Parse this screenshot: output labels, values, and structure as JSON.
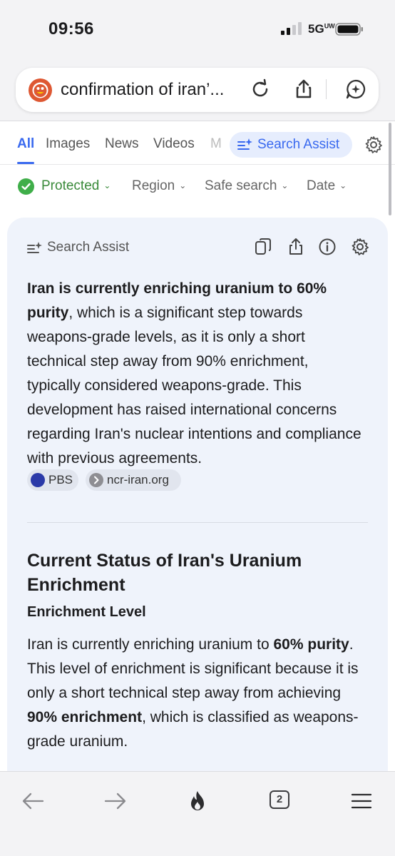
{
  "status_bar": {
    "time": "09:56",
    "network": "5G",
    "network_sup": "UW"
  },
  "url_bar": {
    "query": "confirmation of iran’..."
  },
  "tabs": [
    {
      "label": "All",
      "active": true
    },
    {
      "label": "Images"
    },
    {
      "label": "News"
    },
    {
      "label": "Videos"
    },
    {
      "label": "M"
    }
  ],
  "search_assist_tab": "Search Assist",
  "filters": {
    "protected": "Protected",
    "region": "Region",
    "safe_search": "Safe search",
    "date": "Date"
  },
  "card": {
    "header": "Search Assist",
    "summary_bold": "Iran is currently enriching uranium to 60% purity",
    "summary_rest": ", which is a significant step towards weapons-grade levels, as it is only a short technical step away from 90% enrichment, typically considered weapons-grade. This development has raised international concerns regarding Iran's nuclear intentions and compliance with previous agreements.",
    "sources": [
      {
        "label": "PBS",
        "color": "#2b3aa8"
      },
      {
        "label": "ncr-iran.org",
        "color": "#8e8e93"
      }
    ],
    "heading": "Current Status of Iran's Uranium Enrichment",
    "subheading": "Enrichment Level",
    "para": {
      "t1": "Iran is currently enriching uranium to ",
      "b1": "60% purity",
      "t2": ". This level of enrichment is significant because it is only a short technical step away from achieving ",
      "b2": "90% enrichment",
      "t3": ", which is classified as weapons-grade uranium."
    }
  },
  "toolbar": {
    "tab_count": "2"
  },
  "colors": {
    "accent": "#3969ef",
    "protected_green": "#3fae49",
    "ddg_orange": "#de5833"
  }
}
